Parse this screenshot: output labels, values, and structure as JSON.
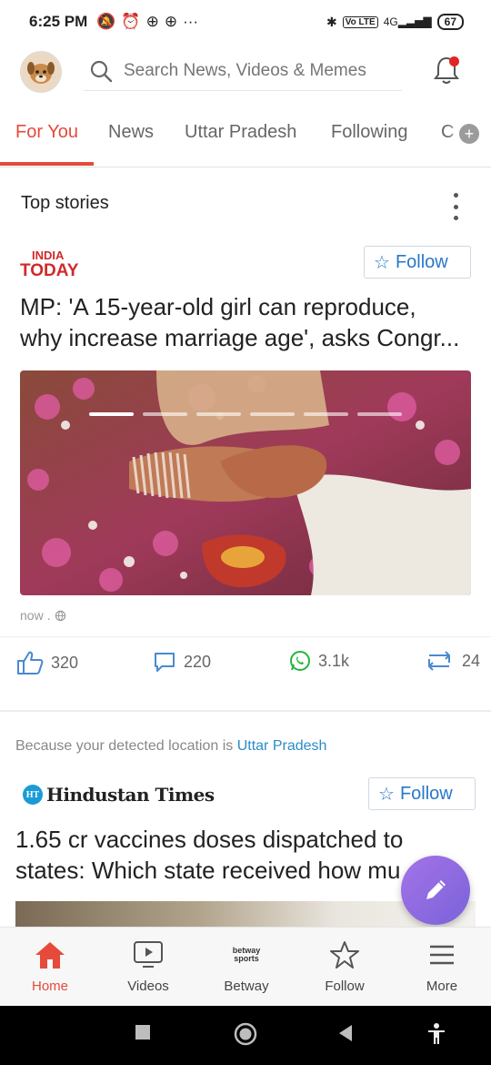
{
  "status_bar": {
    "time": "6:25 PM",
    "left_icons": [
      "silent-bell-icon",
      "alarm-icon",
      "app-icon",
      "app-icon",
      "more-icon"
    ],
    "volte": "Vo LTE",
    "network": "4G",
    "battery": "67"
  },
  "header": {
    "search_placeholder": "Search News, Videos & Memes"
  },
  "tabs": [
    {
      "label": "For You",
      "active": true
    },
    {
      "label": "News",
      "active": false
    },
    {
      "label": "Uttar Pradesh",
      "active": false
    },
    {
      "label": "Following",
      "active": false
    },
    {
      "label": "C",
      "active": false
    }
  ],
  "section": {
    "title": "Top stories"
  },
  "story1": {
    "source_logo_text": [
      "INDIA",
      "TODAY"
    ],
    "follow_label": "Follow",
    "headline_lines": [
      "MP: 'A 15-year-old girl can reproduce,",
      "why increase marriage age', asks Congr..."
    ],
    "carousel_count": 6,
    "carousel_active": 0,
    "time": "now",
    "likes": "320",
    "comments": "220",
    "shares_whatsapp": "3.1k",
    "reposts": "24"
  },
  "story2": {
    "reason_prefix": "Because your detected location is ",
    "reason_location": "Uttar Pradesh",
    "source_badge": "HT",
    "source_name": "Hindustan Times",
    "follow_label": "Follow",
    "headline_lines": [
      "1.65 cr vaccines doses dispatched to",
      "states: Which state received how mu"
    ]
  },
  "bottom_nav": [
    {
      "label": "Home",
      "icon": "home-icon",
      "active": true
    },
    {
      "label": "Videos",
      "icon": "video-icon",
      "active": false
    },
    {
      "label": "Betway",
      "icon": "betway-logo",
      "active": false,
      "logo_text": [
        "betway",
        "sports"
      ]
    },
    {
      "label": "Follow",
      "icon": "star-icon",
      "active": false
    },
    {
      "label": "More",
      "icon": "menu-icon",
      "active": false
    }
  ],
  "colors": {
    "accent": "#e64a3b",
    "link": "#2878c8",
    "fab": "#8f6be2"
  }
}
